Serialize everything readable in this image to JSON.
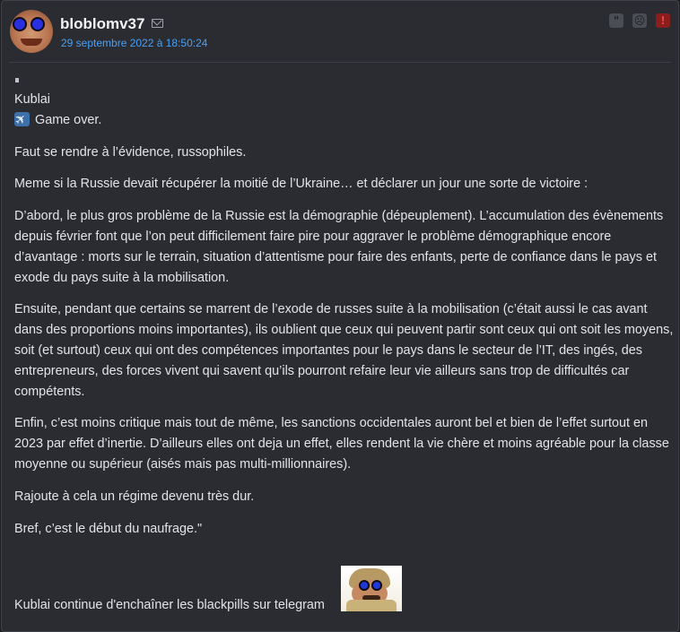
{
  "post": {
    "username": "bloblomv37",
    "date": "29 septembre 2022 à 18:50:24",
    "icons": {
      "mail": "envelope-icon",
      "quote": "quote-icon",
      "sad": "sad-face-icon",
      "report": "report-alert-icon"
    },
    "action_glyphs": {
      "quote": "\"",
      "sad": "☹",
      "report": "!"
    },
    "colors": {
      "background": "#2a2c31",
      "date": "#4aa0f5",
      "alert": "#8b1d1d"
    }
  },
  "message": {
    "author_line": "Kublai",
    "game_over": "Game over.",
    "paragraphs": [
      "Faut se rendre à l’évidence, russophiles.",
      "Meme si la Russie devait récupérer la moitié de l’Ukraine… et déclarer un jour une sorte de victoire :",
      "D’abord, le plus gros problème de la Russie est la démographie (dépeuplement). L’accumulation des évènements depuis février font que l’on peut difficilement faire pire pour aggraver le problème démographique encore d’avantage : morts sur le terrain, situation d’attentisme pour faire des enfants, perte de confiance dans le pays et exode du pays suite à la mobilisation.",
      "Ensuite, pendant que certains se marrent de l’exode de russes suite à la mobilisation (c’était aussi le cas avant dans des proportions moins importantes), ils oublient que ceux qui peuvent partir sont ceux qui ont soit les moyens, soit (et surtout) ceux qui ont des compétences importantes pour le pays dans le secteur de l’IT, des ingés, des entrepreneurs, des forces vivent qui savent qu’ils pourront refaire leur vie ailleurs sans trop de difficultés car compétents.",
      "Enfin, c’est moins critique mais tout de même, les sanctions occidentales auront bel et bien de l’effet surtout en 2023 par effet d’inertie. D’ailleurs elles ont deja un effet, elles rendent la vie chère et moins agréable pour la classe moyenne ou supérieur (aisés mais pas multi-millionnaires).",
      "Rajoute à cela un régime devenu très dur.",
      "Bref, c’est le début du naufrage.\""
    ],
    "closing_line": "Kublai continue d'enchaîner les blackpills sur telegram"
  }
}
